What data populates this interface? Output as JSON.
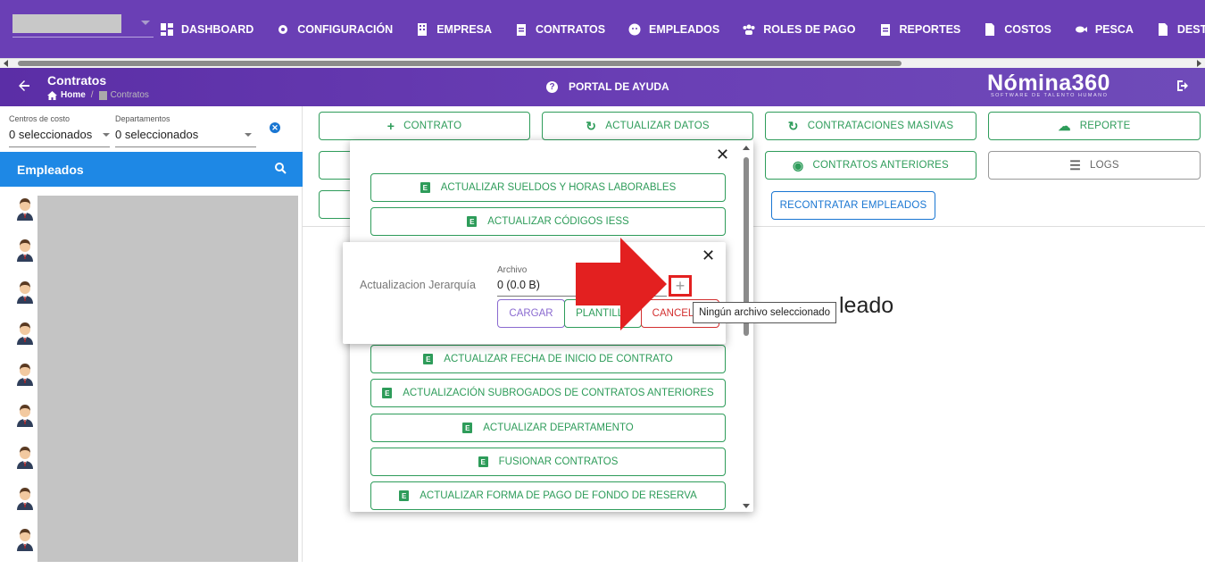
{
  "topnav": {
    "items": [
      {
        "label": "DASHBOARD",
        "icon": "dashboard-icon"
      },
      {
        "label": "CONFIGURACIÓN",
        "icon": "gear-icon"
      },
      {
        "label": "EMPRESA",
        "icon": "building-icon"
      },
      {
        "label": "CONTRATOS",
        "icon": "clipboard-icon"
      },
      {
        "label": "EMPLEADOS",
        "icon": "face-icon"
      },
      {
        "label": "ROLES DE PAGO",
        "icon": "group-icon"
      },
      {
        "label": "REPORTES",
        "icon": "clipboard-icon"
      },
      {
        "label": "COSTOS",
        "icon": "dollar-file-icon"
      },
      {
        "label": "PESCA",
        "icon": "fish-icon"
      },
      {
        "label": "DESTAJO",
        "icon": "document-icon"
      }
    ]
  },
  "header": {
    "title": "Contratos",
    "breadcrumb_home": "Home",
    "breadcrumb_current": "Contratos",
    "help": "PORTAL DE AYUDA",
    "logo": "Nómina360",
    "logo_sub": "SOFTWARE DE TALENTO HUMANO"
  },
  "filters": {
    "cost_label": "Centros de costo",
    "cost_value": "0 seleccionados",
    "dept_label": "Departamentos",
    "dept_value": "0 seleccionados"
  },
  "employees": {
    "title": "Empleados",
    "avatar_count": 9
  },
  "toolbar": {
    "contrato": "CONTRATO",
    "actualizar": "ACTUALIZAR DATOS",
    "masivas": "CONTRATACIONES MASIVAS",
    "reporte": "REPORTE",
    "anteriores": "CONTRATOS ANTERIORES",
    "logs": "LOGS",
    "recontratar": "RECONTRATAR EMPLEADOS"
  },
  "background_text": "leado",
  "menu": {
    "items": [
      "ACTUALIZAR SUELDOS Y HORAS LABORABLES",
      "ACTUALIZAR CÓDIGOS IESS",
      "ACTUALIZAR FECHA DE INICIO DE CONTRATO",
      "ACTUALIZACIÓN SUBROGADOS DE CONTRATOS ANTERIORES",
      "ACTUALIZAR DEPARTAMENTO",
      "FUSIONAR CONTRATOS",
      "ACTUALIZAR FORMA DE PAGO DE FONDO DE RESERVA"
    ]
  },
  "dialog": {
    "label": "Actualizacion Jerarquía",
    "field_label": "Archivo",
    "field_value": "0 (0.0 B)",
    "cargar": "CARGAR",
    "plantilla": "PLANTILLA",
    "cancelar": "CANCELAR"
  },
  "tooltip": "Ningún archivo seleccionado"
}
